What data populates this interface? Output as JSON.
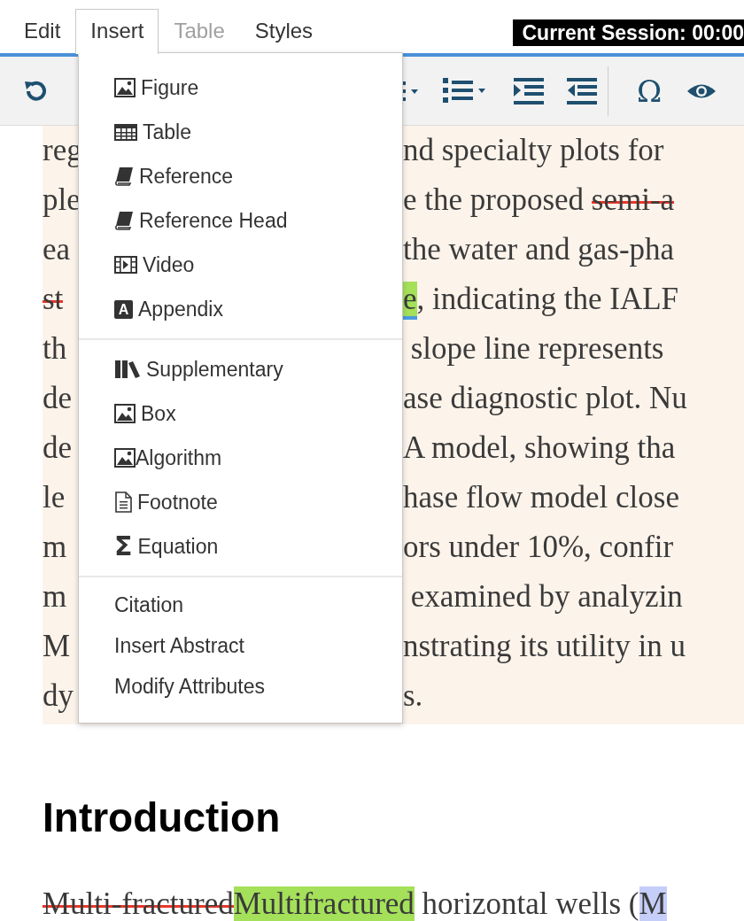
{
  "menubar": [
    {
      "label": "Edit",
      "selected": false,
      "disabled": false
    },
    {
      "label": "Insert",
      "selected": true,
      "disabled": false
    },
    {
      "label": "Table",
      "selected": false,
      "disabled": true
    },
    {
      "label": "Styles",
      "selected": false,
      "disabled": false
    }
  ],
  "session": "Current Session: 00:00",
  "toolbar": [
    {
      "kind": "undo"
    },
    {
      "kind": "bullet-list"
    },
    {
      "kind": "numbered-list"
    },
    {
      "kind": "indent"
    },
    {
      "kind": "outdent"
    },
    {
      "kind": "separator"
    },
    {
      "kind": "glyph",
      "glyph": "Ω"
    },
    {
      "kind": "eye"
    }
  ],
  "insert_menu": {
    "groups": [
      {
        "items": [
          {
            "label": "Figure",
            "kind": "image"
          },
          {
            "label": "Table",
            "kind": "table"
          },
          {
            "label": "Reference",
            "kind": "book"
          },
          {
            "label": "Reference Head",
            "kind": "book"
          },
          {
            "label": "Video",
            "kind": "film"
          },
          {
            "label": "Appendix",
            "kind": "letter",
            "glyph": "A"
          }
        ]
      },
      {
        "items": [
          {
            "label": "Supplementary",
            "kind": "books"
          },
          {
            "label": "Box",
            "kind": "image"
          },
          {
            "label": "Algorithm",
            "kind": "tight"
          },
          {
            "label": "Footnote",
            "kind": "document"
          },
          {
            "label": "Equation",
            "kind": "glyph",
            "glyph": "Σ"
          }
        ]
      },
      {
        "items": [
          {
            "label": "Citation"
          },
          {
            "label": "Insert Abstract"
          },
          {
            "label": "Modify Attributes"
          }
        ]
      }
    ]
  },
  "abstract_lines": [
    {
      "left": [
        {
          "text": "reg",
          "kind": "plain"
        }
      ],
      "right": [
        {
          "text": "nd specialty plots for",
          "kind": "plain"
        }
      ]
    },
    {
      "left": [
        {
          "text": "ple",
          "kind": "plain"
        }
      ],
      "right": [
        {
          "text": "e the proposed ",
          "kind": "plain"
        },
        {
          "text": "semi-a",
          "kind": "deleted"
        }
      ]
    },
    {
      "left": [
        {
          "text": "ea",
          "kind": "plain"
        }
      ],
      "right": [
        {
          "text": "the water and gas-pha",
          "kind": "plain"
        }
      ]
    },
    {
      "left": [
        {
          "text": "st",
          "kind": "deleted"
        }
      ],
      "right": [
        {
          "text": "e",
          "kind": "inserted"
        },
        {
          "text": ", indicating the IALF",
          "kind": "plain"
        }
      ]
    },
    {
      "left": [
        {
          "text": "th",
          "kind": "plain"
        }
      ],
      "right": [
        {
          "text": " slope line represents",
          "kind": "plain"
        }
      ]
    },
    {
      "left": [
        {
          "text": "de",
          "kind": "plain"
        }
      ],
      "right": [
        {
          "text": "ase diagnostic plot. Nu",
          "kind": "plain"
        }
      ]
    },
    {
      "left": [
        {
          "text": "de",
          "kind": "plain"
        }
      ],
      "right": [
        {
          "text": "A model, showing tha",
          "kind": "plain"
        }
      ]
    },
    {
      "left": [
        {
          "text": "le",
          "kind": "plain"
        }
      ],
      "right": [
        {
          "text": "hase flow model close",
          "kind": "plain"
        }
      ]
    },
    {
      "left": [
        {
          "text": "m",
          "kind": "plain"
        }
      ],
      "right": [
        {
          "text": "ors under 10%, confir",
          "kind": "plain"
        }
      ]
    },
    {
      "left": [
        {
          "text": "m",
          "kind": "plain"
        }
      ],
      "right": [
        {
          "text": " examined by analyzin",
          "kind": "plain"
        }
      ]
    },
    {
      "left": [
        {
          "text": "M",
          "kind": "plain"
        }
      ],
      "right": [
        {
          "text": "nstrating its utility in u",
          "kind": "plain"
        }
      ]
    },
    {
      "left": [
        {
          "text": "dy",
          "kind": "plain"
        }
      ],
      "right": [
        {
          "text": "s.",
          "kind": "plain"
        }
      ]
    }
  ],
  "heading": "Introduction",
  "intro_line": [
    {
      "text": "Multi-fractured",
      "kind": "deleted"
    },
    {
      "text": "Multifractured",
      "kind": "inserted"
    },
    {
      "text": " horizontal wells (",
      "kind": "plain"
    },
    {
      "text": "M",
      "kind": "highlighted"
    }
  ]
}
